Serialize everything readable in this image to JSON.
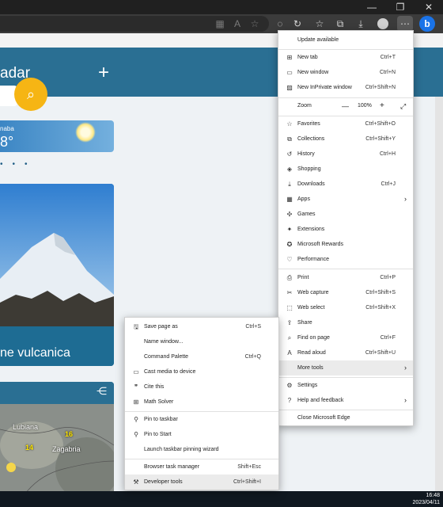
{
  "titlebar": {
    "minimize": "—",
    "maximize": "❐",
    "close": "✕"
  },
  "toolbar": {
    "bing_label": "b"
  },
  "page": {
    "hero_title": "adar",
    "add_symbol": "+",
    "weather_city": "naba",
    "weather_temp": "8°",
    "photo_caption": "ne vulcanica",
    "map_labels": [
      "Lubiana",
      "Zagabria"
    ],
    "map_numbers": [
      "16",
      "14"
    ]
  },
  "main_menu": {
    "update_available": "Update available",
    "new_tab": {
      "label": "New tab",
      "shortcut": "Ctrl+T"
    },
    "new_window": {
      "label": "New window",
      "shortcut": "Ctrl+N"
    },
    "new_inprivate": {
      "label": "New InPrivate window",
      "shortcut": "Ctrl+Shift+N"
    },
    "zoom": {
      "label": "Zoom",
      "minus": "—",
      "value": "100%",
      "plus": "+"
    },
    "favorites": {
      "label": "Favorites",
      "shortcut": "Ctrl+Shift+O"
    },
    "collections": {
      "label": "Collections",
      "shortcut": "Ctrl+Shift+Y"
    },
    "history": {
      "label": "History",
      "shortcut": "Ctrl+H"
    },
    "shopping": {
      "label": "Shopping"
    },
    "downloads": {
      "label": "Downloads",
      "shortcut": "Ctrl+J"
    },
    "apps": {
      "label": "Apps"
    },
    "games": {
      "label": "Games"
    },
    "extensions": {
      "label": "Extensions"
    },
    "rewards": {
      "label": "Microsoft Rewards"
    },
    "performance": {
      "label": "Performance"
    },
    "print": {
      "label": "Print",
      "shortcut": "Ctrl+P"
    },
    "web_capture": {
      "label": "Web capture",
      "shortcut": "Ctrl+Shift+S"
    },
    "web_select": {
      "label": "Web select",
      "shortcut": "Ctrl+Shift+X"
    },
    "share": {
      "label": "Share"
    },
    "find": {
      "label": "Find on page",
      "shortcut": "Ctrl+F"
    },
    "read_aloud": {
      "label": "Read aloud",
      "shortcut": "Ctrl+Shift+U"
    },
    "more_tools": {
      "label": "More tools"
    },
    "settings": {
      "label": "Settings"
    },
    "help": {
      "label": "Help and feedback"
    },
    "close_edge": {
      "label": "Close Microsoft Edge"
    }
  },
  "sub_menu": {
    "save_page": {
      "label": "Save page as",
      "shortcut": "Ctrl+S"
    },
    "name_window": {
      "label": "Name window..."
    },
    "command_palette": {
      "label": "Command Palette",
      "shortcut": "Ctrl+Q"
    },
    "cast": {
      "label": "Cast media to device"
    },
    "cite": {
      "label": "Cite this"
    },
    "math": {
      "label": "Math Solver"
    },
    "pin_taskbar": {
      "label": "Pin to taskbar"
    },
    "pin_start": {
      "label": "Pin to Start"
    },
    "pin_wizard": {
      "label": "Launch taskbar pinning wizard"
    },
    "task_manager": {
      "label": "Browser task manager",
      "shortcut": "Shift+Esc"
    },
    "dev_tools": {
      "label": "Developer tools",
      "shortcut": "Ctrl+Shift+I"
    }
  },
  "taskbar": {
    "time": "16:48",
    "date": "2023/04/11"
  }
}
